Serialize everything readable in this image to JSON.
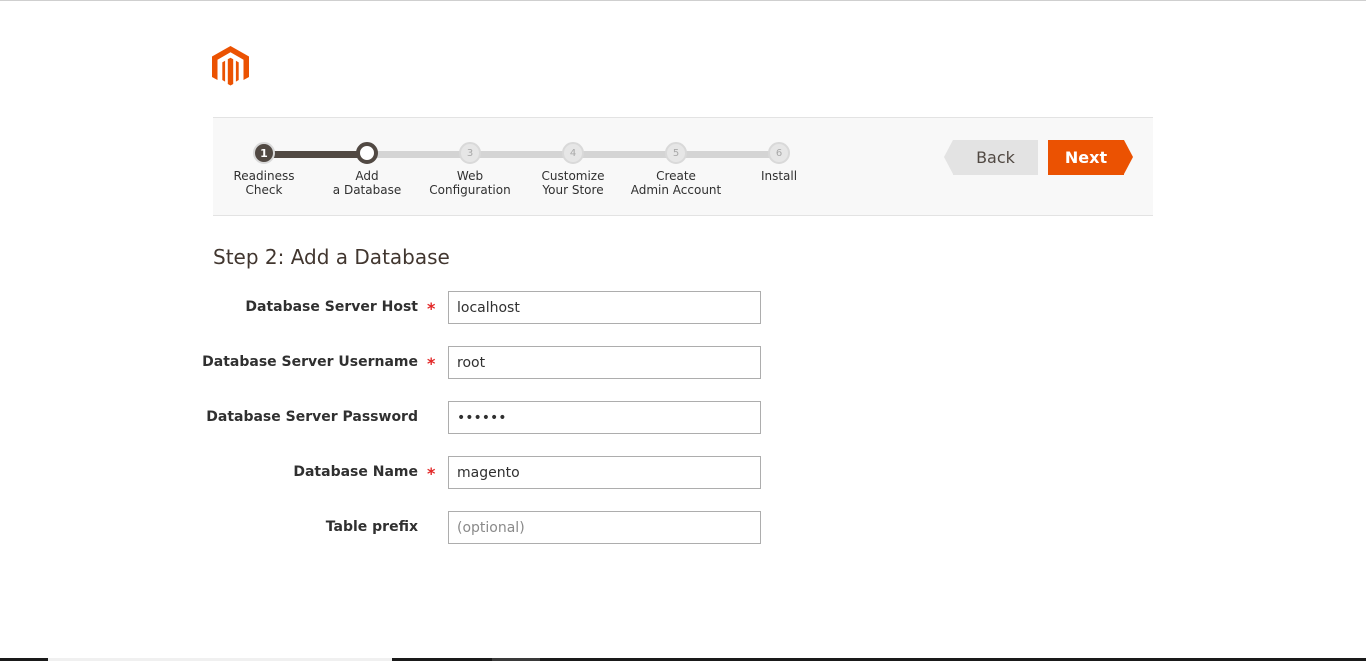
{
  "colors": {
    "brand": "#eb5202",
    "step_done": "#514943",
    "step_pending": "#d4d4d4",
    "required": "#e22626"
  },
  "logo": {
    "icon": "magento-logo"
  },
  "wizard": {
    "steps": [
      {
        "number": "1",
        "label": "Readiness\nCheck",
        "state": "done"
      },
      {
        "number": "",
        "label": "Add\na Database",
        "state": "current"
      },
      {
        "number": "3",
        "label": "Web\nConfiguration",
        "state": "pending"
      },
      {
        "number": "4",
        "label": "Customize\nYour Store",
        "state": "pending"
      },
      {
        "number": "5",
        "label": "Create\nAdmin Account",
        "state": "pending"
      },
      {
        "number": "6",
        "label": "Install",
        "state": "pending"
      }
    ],
    "back_label": "Back",
    "next_label": "Next"
  },
  "page": {
    "title": "Step 2: Add a Database"
  },
  "form": {
    "fields": [
      {
        "label": "Database Server Host",
        "required": true,
        "value": "localhost",
        "placeholder": "",
        "type": "text"
      },
      {
        "label": "Database Server Username",
        "required": true,
        "value": "root",
        "placeholder": "",
        "type": "text"
      },
      {
        "label": "Database Server Password",
        "required": false,
        "value": "••••••",
        "placeholder": "",
        "type": "password"
      },
      {
        "label": "Database Name",
        "required": true,
        "value": "magento",
        "placeholder": "",
        "type": "text"
      },
      {
        "label": "Table prefix",
        "required": false,
        "value": "",
        "placeholder": "(optional)",
        "type": "text"
      }
    ],
    "required_mark": "*"
  }
}
